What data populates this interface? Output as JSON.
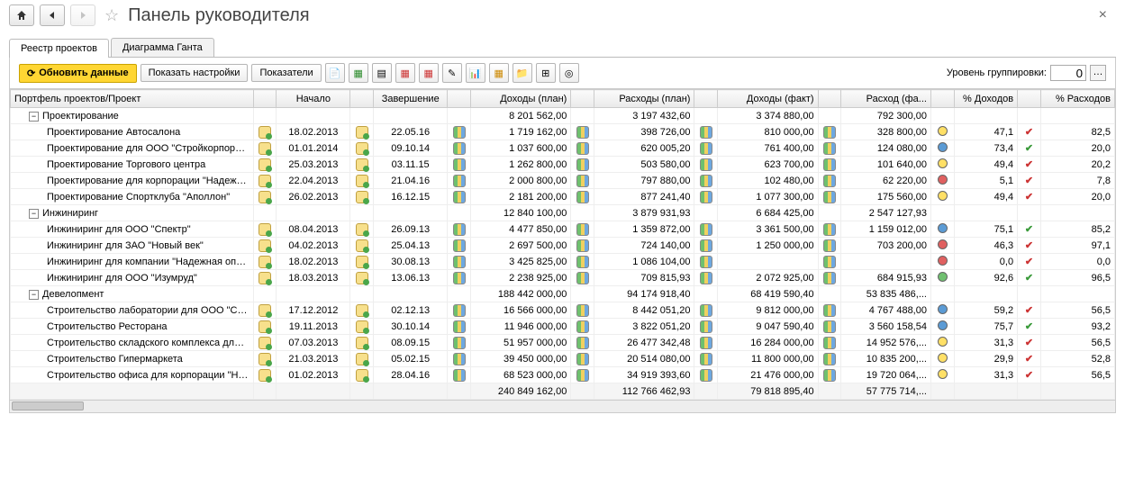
{
  "title": "Панель руководителя",
  "tabs": [
    "Реестр проектов",
    "Диаграмма Ганта"
  ],
  "toolbar": {
    "refresh": "Обновить данные",
    "show_settings": "Показать настройки",
    "indicators": "Показатели",
    "group_level_label": "Уровень группировки:",
    "group_level_value": "0"
  },
  "columns": [
    "Портфель проектов/Проект",
    "",
    "Начало",
    "",
    "Завершение",
    "",
    "Доходы (план)",
    "",
    "Расходы (план)",
    "",
    "Доходы (факт)",
    "",
    "Расход (фа...",
    "",
    "% Доходов",
    "",
    "% Расходов"
  ],
  "groups": [
    {
      "name": "Проектирование",
      "sums": {
        "dp": "8 201 562,00",
        "rp": "3 197 432,60",
        "df": "3 374 880,00",
        "rf": "792 300,00"
      },
      "rows": [
        {
          "name": "Проектирование Автосалона",
          "start": "18.02.2013",
          "end": "22.05.16",
          "dp": "1 719 162,00",
          "rp": "398 726,00",
          "df": "810 000,00",
          "rf": "328 800,00",
          "pd": "47,1",
          "pr": "82,5",
          "dot": "y",
          "c1": "r",
          "c2": "r"
        },
        {
          "name": "Проектирование для ООО \"Стройкорпорац...",
          "start": "01.01.2014",
          "end": "09.10.14",
          "dp": "1 037 600,00",
          "rp": "620 005,20",
          "df": "761 400,00",
          "rf": "124 080,00",
          "pd": "73,4",
          "pr": "20,0",
          "dot": "b",
          "c1": "g",
          "c2": "g"
        },
        {
          "name": "Проектирование Торгового центра",
          "start": "25.03.2013",
          "end": "03.11.15",
          "dp": "1 262 800,00",
          "rp": "503 580,00",
          "df": "623 700,00",
          "rf": "101 640,00",
          "pd": "49,4",
          "pr": "20,2",
          "dot": "y",
          "c1": "r",
          "c2": "g"
        },
        {
          "name": "Проектирование для корпорации \"Надежн...",
          "start": "22.04.2013",
          "end": "21.04.16",
          "dp": "2 000 800,00",
          "rp": "797 880,00",
          "df": "102 480,00",
          "rf": "62 220,00",
          "pd": "5,1",
          "pr": "7,8",
          "dot": "r",
          "c1": "r",
          "c2": "g"
        },
        {
          "name": "Проектирование Спортклуба \"Аполлон\"",
          "start": "26.02.2013",
          "end": "16.12.15",
          "dp": "2 181 200,00",
          "rp": "877 241,40",
          "df": "1 077 300,00",
          "rf": "175 560,00",
          "pd": "49,4",
          "pr": "20,0",
          "dot": "y",
          "c1": "r",
          "c2": "g"
        }
      ]
    },
    {
      "name": "Инжиниринг",
      "sums": {
        "dp": "12 840 100,00",
        "rp": "3 879 931,93",
        "df": "6 684 425,00",
        "rf": "2 547 127,93"
      },
      "rows": [
        {
          "name": "Инжиниринг для ООО \"Спектр\"",
          "start": "08.04.2013",
          "end": "26.09.13",
          "dp": "4 477 850,00",
          "rp": "1 359 872,00",
          "df": "3 361 500,00",
          "rf": "1 159 012,00",
          "pd": "75,1",
          "pr": "85,2",
          "dot": "b",
          "c1": "g",
          "c2": "r"
        },
        {
          "name": "Инжиниринг для ЗАО \"Новый век\"",
          "start": "04.02.2013",
          "end": "25.04.13",
          "dp": "2 697 500,00",
          "rp": "724 140,00",
          "df": "1 250 000,00",
          "rf": "703 200,00",
          "pd": "46,3",
          "pr": "97,1",
          "dot": "r",
          "c1": "r",
          "c2": "r"
        },
        {
          "name": "Инжиниринг для компании \"Надежная опо...",
          "start": "18.02.2013",
          "end": "30.08.13",
          "dp": "3 425 825,00",
          "rp": "1 086 104,00",
          "df": "",
          "rf": "",
          "pd": "0,0",
          "pr": "0,0",
          "dot": "r",
          "c1": "r",
          "c2": "g"
        },
        {
          "name": "Инжиниринг для ООО \"Изумруд\"",
          "start": "18.03.2013",
          "end": "13.06.13",
          "dp": "2 238 925,00",
          "rp": "709 815,93",
          "df": "2 072 925,00",
          "rf": "684 915,93",
          "pd": "92,6",
          "pr": "96,5",
          "dot": "g",
          "c1": "g",
          "c2": "r"
        }
      ]
    },
    {
      "name": "Девелопмент",
      "sums": {
        "dp": "188 442 000,00",
        "rp": "94 174 918,40",
        "df": "68 419 590,40",
        "rf": "53 835 486,..."
      },
      "rows": [
        {
          "name": "Строительство лаборатории для ООО \"Спе...",
          "start": "17.12.2012",
          "end": "02.12.13",
          "dp": "16 566 000,00",
          "rp": "8 442 051,20",
          "df": "9 812 000,00",
          "rf": "4 767 488,00",
          "pd": "59,2",
          "pr": "56,5",
          "dot": "b",
          "c1": "r",
          "c2": "g"
        },
        {
          "name": "Строительство Ресторана",
          "start": "19.11.2013",
          "end": "30.10.14",
          "dp": "11 946 000,00",
          "rp": "3 822 051,20",
          "df": "9 047 590,40",
          "rf": "3 560 158,54",
          "pd": "75,7",
          "pr": "93,2",
          "dot": "b",
          "c1": "g",
          "c2": "r"
        },
        {
          "name": "Строительство складского комплекса для ...",
          "start": "07.03.2013",
          "end": "08.09.15",
          "dp": "51 957 000,00",
          "rp": "26 477 342,48",
          "df": "16 284 000,00",
          "rf": "14 952 576,...",
          "pd": "31,3",
          "pr": "56,5",
          "dot": "y",
          "c1": "r",
          "c2": "g"
        },
        {
          "name": "Строительство Гипермаркета",
          "start": "21.03.2013",
          "end": "05.02.15",
          "dp": "39 450 000,00",
          "rp": "20 514 080,00",
          "df": "11 800 000,00",
          "rf": "10 835 200,...",
          "pd": "29,9",
          "pr": "52,8",
          "dot": "y",
          "c1": "r",
          "c2": "g"
        },
        {
          "name": "Строительство офиса для корпорации \"На...",
          "start": "01.02.2013",
          "end": "28.04.16",
          "dp": "68 523 000,00",
          "rp": "34 919 393,60",
          "df": "21 476 000,00",
          "rf": "19 720 064,...",
          "pd": "31,3",
          "pr": "56,5",
          "dot": "y",
          "c1": "r",
          "c2": "g"
        }
      ]
    }
  ],
  "totals": {
    "dp": "240 849 162,00",
    "rp": "112 766 462,93",
    "df": "79 818 895,40",
    "rf": "57 775 714,..."
  }
}
